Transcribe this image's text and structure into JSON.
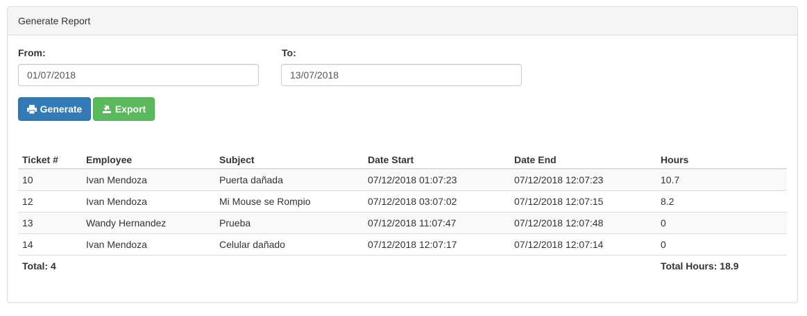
{
  "panel": {
    "title": "Generate Report"
  },
  "form": {
    "from_label": "From:",
    "from_value": "01/07/2018",
    "to_label": "To:",
    "to_value": "13/07/2018"
  },
  "buttons": {
    "generate_label": "Generate",
    "export_label": "Export",
    "generate_icon": "print-icon",
    "export_icon": "export-icon"
  },
  "table": {
    "headers": [
      "Ticket #",
      "Employee",
      "Subject",
      "Date Start",
      "Date End",
      "Hours"
    ],
    "rows": [
      [
        "10",
        "Ivan Mendoza",
        "Puerta dañada",
        "07/12/2018 01:07:23",
        "07/12/2018 12:07:23",
        "10.7"
      ],
      [
        "12",
        "Ivan Mendoza",
        "Mi Mouse se Rompio",
        "07/12/2018 03:07:02",
        "07/12/2018 12:07:15",
        "8.2"
      ],
      [
        "13",
        "Wandy Hernandez",
        "Prueba",
        "07/12/2018 11:07:47",
        "07/12/2018 12:07:48",
        "0"
      ],
      [
        "14",
        "Ivan Mendoza",
        "Celular dañado",
        "07/12/2018 12:07:17",
        "07/12/2018 12:07:14",
        "0"
      ]
    ],
    "total_label": "Total: 4",
    "total_hours_label": "Total Hours: 18.9"
  },
  "colors": {
    "primary": "#337ab7",
    "success": "#5cb85c",
    "heading_bg": "#f5f5f5",
    "border": "#dddddd"
  }
}
